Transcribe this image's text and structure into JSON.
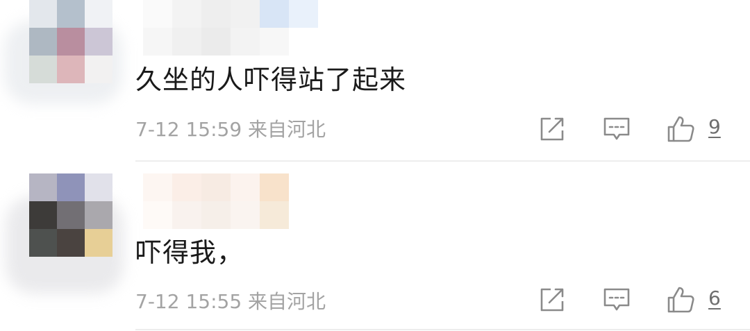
{
  "comments": [
    {
      "text": "久坐的人吓得站了起来",
      "time": "7-12 15:59",
      "location": "来自河北",
      "likes": "9",
      "avatar_blocks": [
        "#e3e7ec",
        "#b4c0cc",
        "#f0f2f5",
        "#aeb8c2",
        "#b98e9f",
        "#ccc6d6",
        "#d6dcd8",
        "#ddb6ba",
        "#f2f1f1"
      ],
      "name_blocks": [
        "#fafafa",
        "#f3f3f3",
        "#eeeeee",
        "#f1f1f1",
        "#d8e5f6",
        "#e9f1fb"
      ],
      "name_blocks2": [
        "#f6f6f6",
        "#f0f0f0",
        "#ebebeb",
        "#f3f3f3",
        "#f7f7f7",
        "#ffffff"
      ]
    },
    {
      "text": "吓得我，",
      "time": "7-12 15:55",
      "location": "来自河北",
      "likes": "6",
      "avatar_blocks": [
        "#b6b5c3",
        "#8f93b9",
        "#e1e1ea",
        "#3d3b39",
        "#726f74",
        "#aaa8ad",
        "#4e514f",
        "#4a4340",
        "#e7cf96"
      ],
      "name_blocks": [
        "#fdf6f2",
        "#fbeee7",
        "#f7ebe3",
        "#fcf3ee",
        "#f8e2cb",
        "#ffffff"
      ],
      "name_blocks2": [
        "#fefaf7",
        "#f9f2ee",
        "#f6efe9",
        "#faf4f0",
        "#f6ead9",
        "#ffffff"
      ]
    }
  ],
  "icons": {
    "share": "share-icon",
    "comment": "comment-icon",
    "like": "thumbs-up-icon"
  }
}
